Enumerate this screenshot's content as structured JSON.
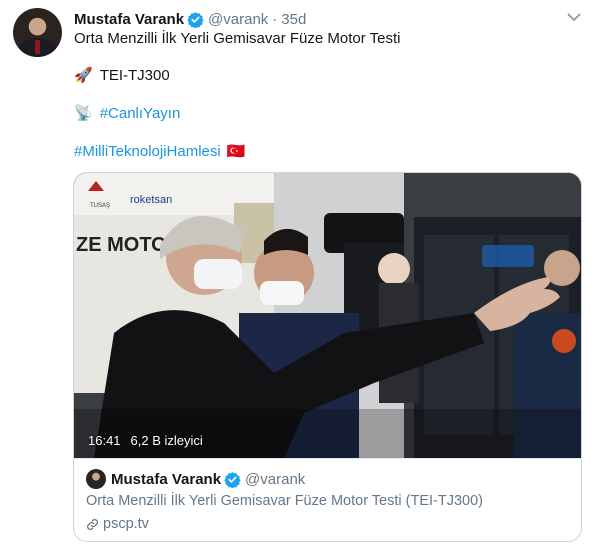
{
  "tweet": {
    "author_name": "Mustafa Varank",
    "handle": "@varank",
    "separator": "·",
    "time": "35d",
    "text_line1": "Orta Menzilli İlk Yerli Gemisavar Füze Motor Testi",
    "line2_emoji": "🚀",
    "line2_text": "TEI-TJ300",
    "line3_emoji": "📡",
    "line3_hashtag": "#CanlıYayın",
    "line4_hashtag": "#MilliTeknolojiHamlesi",
    "line4_emoji": "🇹🇷"
  },
  "video": {
    "duration": "16:41",
    "views": "6,2 B izleyici",
    "wall_sign": "ZE MOTOR",
    "logo_text": "roketsan",
    "tusas_text": "TUSAŞ"
  },
  "card": {
    "author_name": "Mustafa Varank",
    "handle": "@varank",
    "description": "Orta Menzilli İlk Yerli Gemisavar Füze Motor Testi (TEI-TJ300)",
    "domain": "pscp.tv"
  },
  "colors": {
    "accent": "#1b95e0",
    "muted": "#657786",
    "text": "#14171a",
    "verified": "#1da1f2"
  },
  "icons": {
    "verified": "verified-badge-icon",
    "menu": "chevron-down-icon",
    "link": "link-icon"
  }
}
